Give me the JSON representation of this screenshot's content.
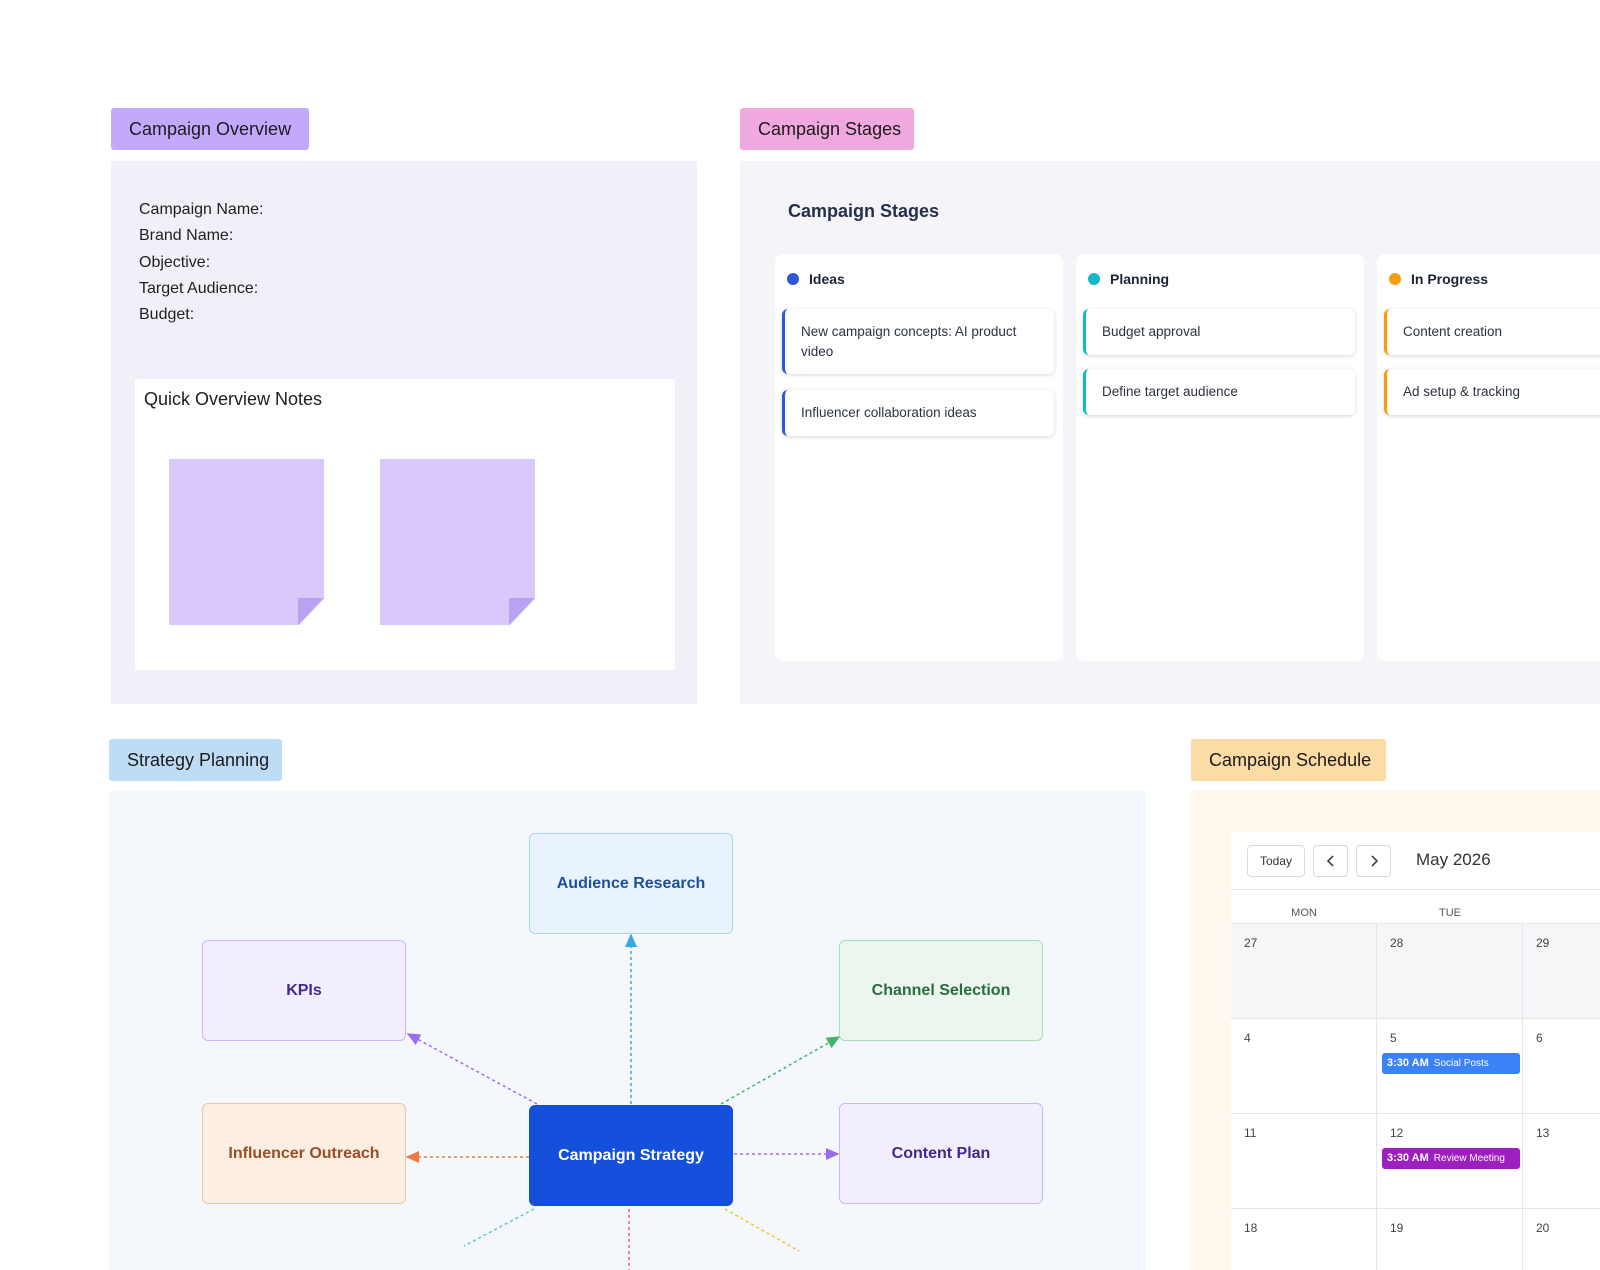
{
  "overview": {
    "label": "Campaign Overview",
    "fields": [
      "Campaign Name:",
      "Brand Name:",
      "Objective:",
      "Target Audience:",
      "Budget:"
    ],
    "notes_title": "Quick Overview Notes",
    "label_color": "#c3a9fb",
    "sticky_color": "#d9c9fb"
  },
  "stages": {
    "label": "Campaign Stages",
    "title": "Campaign Stages",
    "label_color": "#f0a9df",
    "columns": [
      {
        "name": "Ideas",
        "color": "#2f56d6",
        "cards": [
          "New campaign concepts: AI product video",
          "Influencer collaboration ideas"
        ]
      },
      {
        "name": "Planning",
        "color": "#14b8c9",
        "cards": [
          "Budget approval",
          "Define target audience"
        ]
      },
      {
        "name": "In Progress",
        "color": "#f59e0b",
        "cards": [
          "Content creation",
          "Ad setup & tracking"
        ]
      }
    ]
  },
  "strategy": {
    "label": "Strategy Planning",
    "label_color": "#bedcf6",
    "center": "Campaign Strategy",
    "nodes": {
      "audience": "Audience Research",
      "kpis": "KPIs",
      "channel": "Channel Selection",
      "influencer": "Influencer Outreach",
      "content": "Content Plan"
    }
  },
  "schedule": {
    "label": "Campaign Schedule",
    "label_color": "#fcdba4",
    "today": "Today",
    "month": "May 2026",
    "days_of_week": [
      "MON",
      "TUE"
    ],
    "weeks": [
      [
        "27",
        "28",
        "29"
      ],
      [
        "4",
        "5",
        "6"
      ],
      [
        "11",
        "12",
        "13"
      ],
      [
        "18",
        "19",
        "20"
      ]
    ],
    "events": [
      {
        "time": "3:30 AM",
        "title": "Social Posts",
        "color": "#3b82f6"
      },
      {
        "time": "3:30 AM",
        "title": "Review Meeting",
        "color": "#9d1fbf"
      }
    ]
  }
}
